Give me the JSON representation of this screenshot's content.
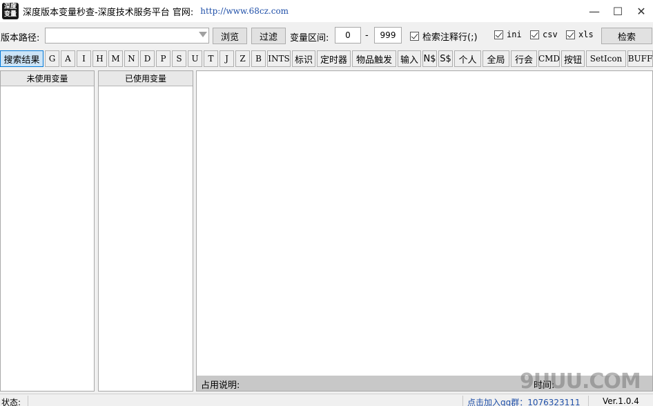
{
  "window": {
    "icon_text": [
      "深度",
      "变量"
    ],
    "title": "深度版本变量秒查-深度技术服务平台 官网:",
    "url": "http://www.68cz.com",
    "controls": {
      "minimize": "—",
      "maximize": "☐",
      "close": "✕"
    }
  },
  "toolbar": {
    "path_label": "版本路径:",
    "path_value": "",
    "browse_label": "浏览",
    "filter_label": "过滤",
    "range_label": "变量区间:",
    "range_from": "0",
    "range_dash": "-",
    "range_to": "999",
    "checkboxes": [
      {
        "label": "检索注释行(;)",
        "checked": true
      },
      {
        "label": "ini",
        "checked": true
      },
      {
        "label": "csv",
        "checked": true
      },
      {
        "label": "xls",
        "checked": true
      }
    ],
    "search_label": "检索"
  },
  "tabs": [
    {
      "label": "搜索结果",
      "active": true
    },
    {
      "label": "G"
    },
    {
      "label": "A"
    },
    {
      "label": "I"
    },
    {
      "label": "H"
    },
    {
      "label": "M"
    },
    {
      "label": "N"
    },
    {
      "label": "D"
    },
    {
      "label": "P"
    },
    {
      "label": "S"
    },
    {
      "label": "U"
    },
    {
      "label": "T"
    },
    {
      "label": "J"
    },
    {
      "label": "Z"
    },
    {
      "label": "B"
    },
    {
      "label": "INTS"
    },
    {
      "label": "标识"
    },
    {
      "label": "定时器"
    },
    {
      "label": "物品触发"
    },
    {
      "label": "输入"
    },
    {
      "label": "N$"
    },
    {
      "label": "S$"
    },
    {
      "label": "个人"
    },
    {
      "label": "全局"
    },
    {
      "label": "行会"
    },
    {
      "label": "CMD"
    },
    {
      "label": "按钮"
    },
    {
      "label": "SetIcon"
    },
    {
      "label": "BUFF"
    }
  ],
  "panels": {
    "unused_title": "未使用变量",
    "used_title": "已使用变量"
  },
  "info_bar": {
    "usage_label": "占用说明:",
    "time_label": "时间:",
    "watermark": "9UUU.COM"
  },
  "status_bar": {
    "status_label": "状态:",
    "qq_link": "点击加入qq群：1076323111",
    "version": "Ver.1.0.4"
  }
}
